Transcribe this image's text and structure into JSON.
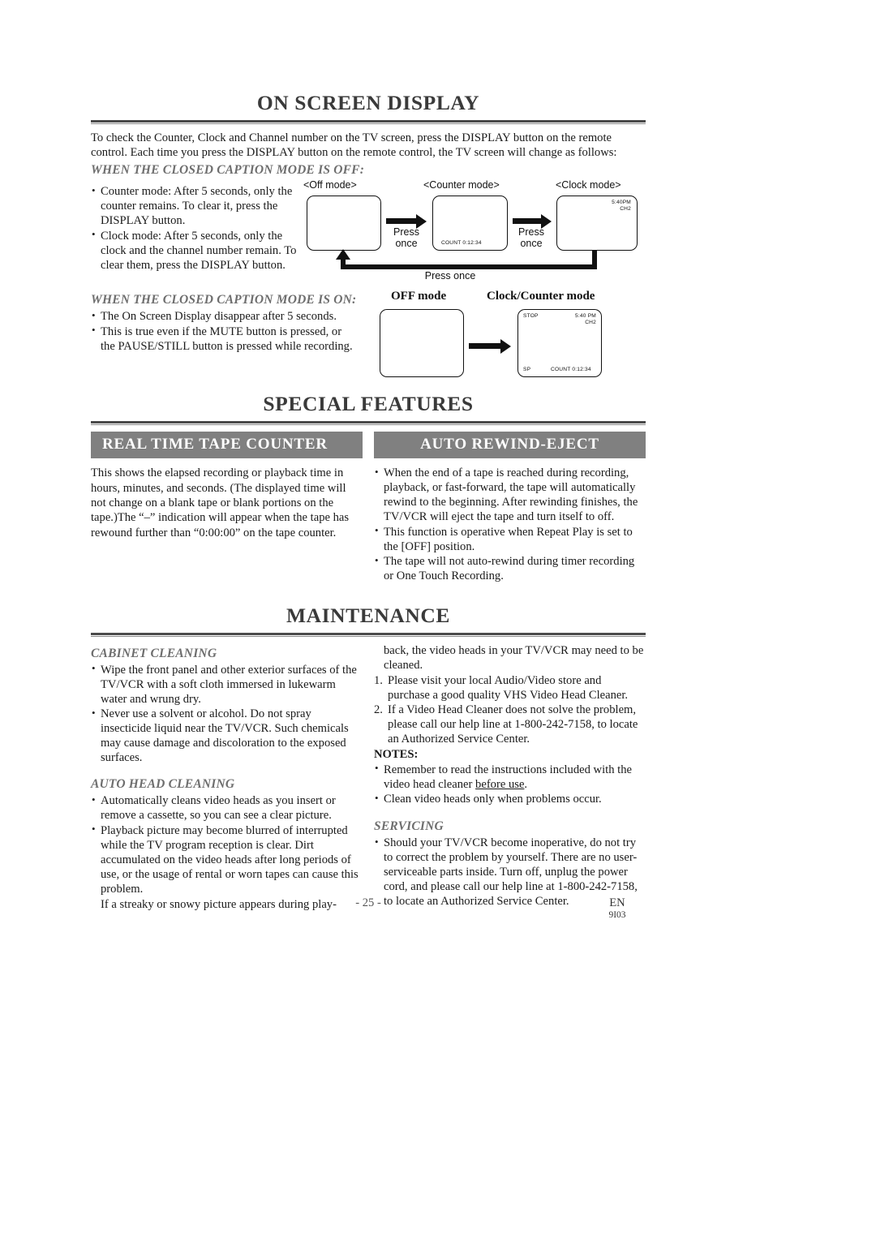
{
  "page": {
    "number_label": "- 25 -",
    "lang_code": "EN",
    "doc_code": "9I03"
  },
  "on_screen_display": {
    "title": "ON SCREEN DISPLAY",
    "intro": "To check the Counter, Clock and Channel number on the TV screen, press the DISPLAY button on the remote control. Each time you press the DISPLAY button on the remote control, the TV screen will change as follows:",
    "cc_off": {
      "heading": "WHEN THE CLOSED CAPTION MODE IS OFF:",
      "bullets": [
        "Counter mode: After 5 seconds, only the counter remains. To clear it, press the DISPLAY button.",
        "Clock mode: After 5 seconds, only the clock and the channel number remain. To clear them, press the DISPLAY button."
      ],
      "diagram": {
        "labels": {
          "off_mode": "<Off mode>",
          "counter_mode": "<Counter mode>",
          "clock_mode": "<Clock mode>"
        },
        "press_once_1": "Press\nonce",
        "press_once_2": "Press\nonce",
        "press_once_loop": "Press once",
        "counter_screen_text": "COUNT  0:12:34",
        "clock_screen_time": "5:40PM",
        "clock_screen_channel": "CH2"
      }
    },
    "cc_on": {
      "heading": "WHEN THE CLOSED CAPTION MODE IS ON:",
      "bullets": [
        "The On Screen Display disappear after 5 seconds.",
        "This is true even if the MUTE button is pressed, or the PAUSE/STILL button is pressed while recording."
      ],
      "diagram": {
        "off_mode_label": "OFF mode",
        "clock_counter_label": "Clock/Counter mode",
        "screen_status": "STOP",
        "screen_time": "5:40 PM",
        "screen_channel": "CH2",
        "screen_speed": "SP",
        "screen_counter": "COUNT  0:12:34"
      }
    }
  },
  "special_features": {
    "title": "SPECIAL FEATURES",
    "real_time_tape_counter": {
      "banner": "REAL TIME TAPE COUNTER",
      "body": "This shows the elapsed recording or playback time in hours, minutes, and seconds. (The displayed time will not change on a blank tape or blank portions on the tape.)The “–” indication will appear when the tape has rewound further than “0:00:00” on the tape counter."
    },
    "auto_rewind_eject": {
      "banner": "AUTO REWIND-EJECT",
      "bullets": [
        "When the end of a tape is reached during recording, playback, or fast-forward, the tape will automatically rewind to the beginning. After rewinding finishes, the TV/VCR will eject the tape and turn itself to off.",
        "This function is operative when Repeat Play is set to the [OFF] position.",
        "The tape will not auto-rewind during timer recording or One Touch Recording."
      ]
    }
  },
  "maintenance": {
    "title": "MAINTENANCE",
    "cabinet_cleaning": {
      "heading": "CABINET CLEANING",
      "bullets": [
        "Wipe the front panel and other exterior surfaces of the TV/VCR with a soft cloth immersed in lukewarm water and wrung dry.",
        "Never use a solvent or alcohol. Do not spray insecticide liquid near the TV/VCR. Such chemicals may cause damage and discoloration to the exposed surfaces."
      ]
    },
    "auto_head_cleaning": {
      "heading": "AUTO HEAD CLEANING",
      "bullets": [
        "Automatically cleans video heads as you insert or remove a cassette, so you can see a clear picture.",
        "Playback picture may become blurred of interrupted while the TV program reception is clear. Dirt accumulated on the video heads after long periods of use, or the usage of rental or worn tapes can cause this problem."
      ],
      "continuation_left": "If a streaky or snowy picture appears during play-",
      "continuation_right": "back, the video heads in your TV/VCR may need to be cleaned.",
      "numbered": [
        "Please visit your local Audio/Video store and purchase a good quality VHS Video Head Cleaner.",
        "If a Video Head Cleaner does not solve the problem, please call our help line at 1-800-242-7158, to locate an Authorized Service Center."
      ],
      "notes_label": "NOTES:",
      "notes": [
        {
          "pre": "Remember to read the instructions included with the video head cleaner ",
          "underlined": "before use",
          "post": "."
        }
      ],
      "note_plain": "Clean video heads only when problems occur."
    },
    "servicing": {
      "heading": "SERVICING",
      "bullets": [
        "Should your TV/VCR become inoperative, do not try to correct the problem by yourself. There are no user-serviceable parts inside. Turn off, unplug the power cord, and please call our help line at 1-800-242-7158, to locate an Authorized Service Center."
      ]
    }
  },
  "colors": {
    "banner_bg": "#808080",
    "banner_text": "#ffffff",
    "heading_gray": "#6e6e6e",
    "rule": "#4a4a4a"
  }
}
